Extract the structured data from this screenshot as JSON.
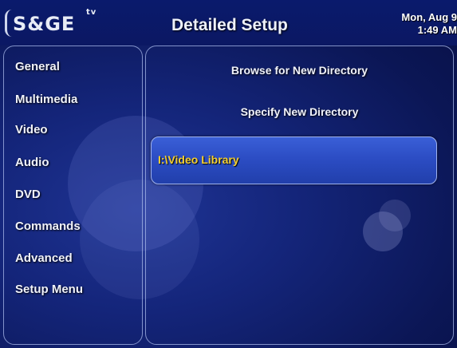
{
  "header": {
    "logo_text": "S&GE",
    "logo_tv": "tv",
    "title": "Detailed Setup",
    "date": "Mon, Aug 9",
    "time": "1:49 AM"
  },
  "sidebar": {
    "items": [
      {
        "label": "General"
      },
      {
        "label": "Multimedia"
      },
      {
        "label": "Video"
      },
      {
        "label": "Audio"
      },
      {
        "label": "DVD"
      },
      {
        "label": "Commands"
      },
      {
        "label": "Advanced"
      },
      {
        "label": "Setup Menu"
      }
    ]
  },
  "main": {
    "options": [
      {
        "label": "Browse for New Directory"
      },
      {
        "label": "Specify New Directory"
      }
    ],
    "selected_directory": "I:\\Video Library"
  },
  "colors": {
    "background": "#14257a",
    "selected_row": "#2c4dc4",
    "selected_text": "#f4cf30",
    "border": "#aab9eb"
  }
}
